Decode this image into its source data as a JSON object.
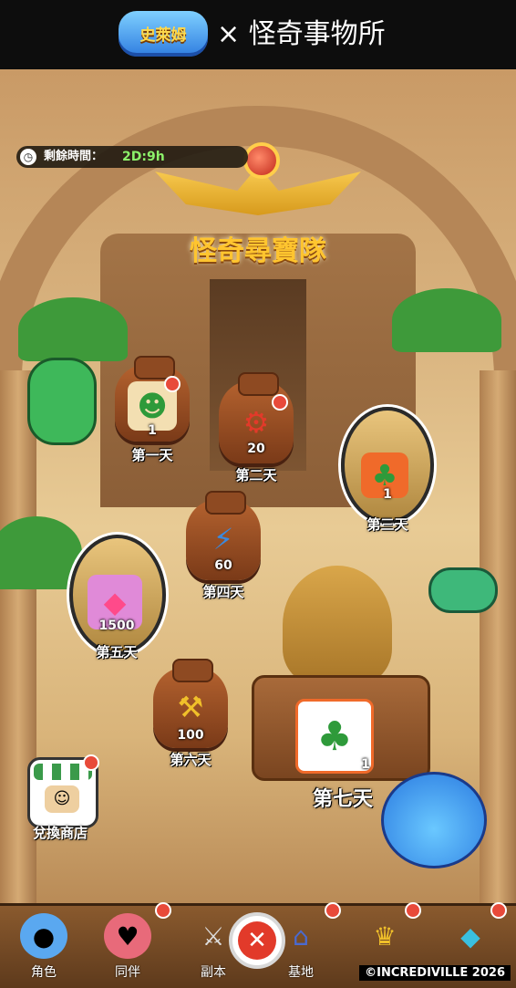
{
  "header": {
    "game_logo_text": "史萊姆",
    "collab_text": "× 怪奇事物所"
  },
  "timer": {
    "label": "剩餘時間：",
    "value": "2D:9h"
  },
  "event_title": "怪奇尋寶隊",
  "rewards": [
    {
      "day": "第一天",
      "count": "1",
      "icon": "green-creature-icon"
    },
    {
      "day": "第二天",
      "count": "20",
      "icon": "red-gear-icon"
    },
    {
      "day": "第三天",
      "count": "1",
      "icon": "green-bird-card-icon"
    },
    {
      "day": "第四天",
      "count": "60",
      "icon": "blue-ticket-icon"
    },
    {
      "day": "第五天",
      "count": "1500",
      "icon": "pink-gem-icon"
    },
    {
      "day": "第六天",
      "count": "100",
      "icon": "hammer-icon"
    },
    {
      "day": "第七天",
      "count": "1",
      "icon": "green-bird-card-icon"
    }
  ],
  "shop": {
    "label": "兌換商店"
  },
  "nav": {
    "items": [
      {
        "label": "角色",
        "icon": "slime-icon"
      },
      {
        "label": "同伴",
        "icon": "companions-icon"
      },
      {
        "label": "副本",
        "icon": "swords-icon"
      },
      {
        "label": "基地",
        "icon": "house-icon"
      },
      {
        "label": "",
        "icon": "crown-banner-icon"
      },
      {
        "label": "",
        "icon": "gem-shop-icon"
      }
    ]
  },
  "copyright": "©INCREDIVILLE 2026",
  "colors": {
    "title_gold": "#ffc52f",
    "timer_green": "#8cf26a",
    "badge_red": "#e84a3a"
  }
}
